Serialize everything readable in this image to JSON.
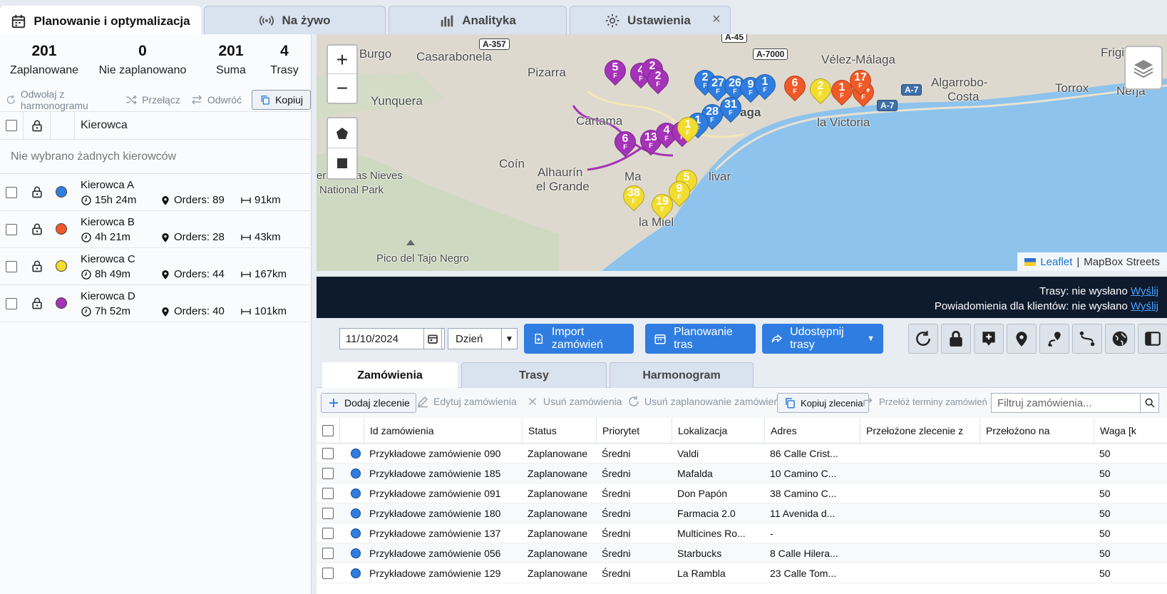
{
  "top_tabs": [
    {
      "label": "Planowanie i optymalizacja",
      "icon": "calendar-icon",
      "active": true
    },
    {
      "label": "Na żywo",
      "icon": "broadcast-icon",
      "active": false
    },
    {
      "label": "Analityka",
      "icon": "bar-chart-icon",
      "active": false
    },
    {
      "label": "Ustawienia",
      "icon": "gear-icon",
      "active": false
    }
  ],
  "tab_close": "×",
  "stats": [
    {
      "value": "201",
      "label": "Zaplanowane"
    },
    {
      "value": "0",
      "label": "Nie zaplanowano"
    },
    {
      "value": "201",
      "label": "Suma"
    },
    {
      "value": "4",
      "label": "Trasy"
    }
  ],
  "left_actions": {
    "unschedule": "Odwołaj z harmonogramu",
    "switch": "Przełącz",
    "reverse": "Odwróć",
    "copy": "Kopiuj"
  },
  "driver_header": {
    "label": "Kierowca"
  },
  "drivers_empty": "Nie wybrano żadnych kierowców",
  "drivers": [
    {
      "name": "Kierowca A",
      "color": "#2f7de1",
      "time": "15h 24m",
      "orders": "Orders: 89",
      "distance": "91km"
    },
    {
      "name": "Kierowca B",
      "color": "#f05a28",
      "time": "4h 21m",
      "orders": "Orders: 28",
      "distance": "43km"
    },
    {
      "name": "Kierowca C",
      "color": "#f2dc2e",
      "time": "8h 49m",
      "orders": "Orders: 44",
      "distance": "167km"
    },
    {
      "name": "Kierowca D",
      "color": "#a533b8",
      "time": "7h 52m",
      "orders": "Orders: 40",
      "distance": "101km"
    }
  ],
  "map": {
    "labels": {
      "el_burgo": "El Burgo",
      "casarabonela": "Casarabonela",
      "pizarra": "Pizarra",
      "yunquera": "Yunquera",
      "cartama": "Cártama",
      "coin": "Coín",
      "alhaurin1": "Alhaurín",
      "alhaurin2": "el Grande",
      "nieves1": "erra de las Nieves",
      "nieves2": "National Park",
      "pico": "Pico del Tajo Negro",
      "velez": "Vélez-Málaga",
      "frigili": "Frigili",
      "algarrobo1": "Algarrobo-",
      "algarrobo2": "Costa",
      "torrox": "Torrox",
      "nerja": "Nerja",
      "victoria": "la Victoria",
      "aga": "aga",
      "livar": "livar",
      "ma": "Ma",
      "la_miel": "la Miel"
    },
    "roads": {
      "a357": "A-357",
      "a45": "A-45",
      "a7000": "A-7000",
      "a7a": "A-7",
      "a7b": "A-7"
    },
    "zoom_in": "+",
    "zoom_out": "−",
    "attribution_leaflet": "Leaflet",
    "attribution_sep": "|",
    "attribution_tiles": "MapBox Streets",
    "pins": [
      {
        "n": "5",
        "f": "F",
        "color": "#a533b8"
      },
      {
        "n": "4",
        "f": "F",
        "color": "#a533b8"
      },
      {
        "n": "2",
        "f": "F",
        "color": "#a533b8"
      },
      {
        "n": "2",
        "f": "F",
        "color": "#a533b8"
      },
      {
        "n": "6",
        "f": "F",
        "color": "#a533b8"
      },
      {
        "n": "13",
        "f": "F",
        "color": "#a533b8"
      },
      {
        "n": "4",
        "f": "F",
        "color": "#a533b8"
      },
      {
        "n": "5",
        "f": "F",
        "color": "#a533b8"
      },
      {
        "n": "2",
        "f": "F",
        "color": "#2f7de1"
      },
      {
        "n": "27",
        "f": "F",
        "color": "#2f7de1"
      },
      {
        "n": "26",
        "f": "F",
        "color": "#2f7de1"
      },
      {
        "n": "9",
        "f": "F",
        "color": "#2f7de1"
      },
      {
        "n": "1",
        "f": "F",
        "color": "#2f7de1"
      },
      {
        "n": "28",
        "f": "F",
        "color": "#2f7de1"
      },
      {
        "n": "31",
        "f": "F",
        "color": "#2f7de1"
      },
      {
        "n": "1",
        "f": "F",
        "color": "#2f7de1"
      },
      {
        "n": "6",
        "f": "F",
        "color": "#f05a28"
      },
      {
        "n": "2",
        "f": "F",
        "color": "#f2dc2e"
      },
      {
        "n": "1",
        "f": "F",
        "color": "#f05a28"
      },
      {
        "n": "14",
        "f": "F",
        "color": "#f05a28"
      },
      {
        "n": "17",
        "f": "F",
        "color": "#f05a28"
      },
      {
        "n": "38",
        "f": "F",
        "color": "#f2dc2e"
      },
      {
        "n": "19",
        "f": "F",
        "color": "#f2dc2e"
      },
      {
        "n": "5",
        "f": "F",
        "color": "#f2dc2e"
      },
      {
        "n": "9",
        "f": "F",
        "color": "#f2dc2e"
      },
      {
        "n": "1",
        "f": "F",
        "color": "#f2dc2e"
      }
    ]
  },
  "status": {
    "routes_label": "Trasy: nie wysłano",
    "routes_link": "Wyślij",
    "notif_label": "Powiadomienia dla klientów: nie wysłano",
    "notif_link": "Wyślij"
  },
  "toolbar": {
    "date": "11/10/2024",
    "period": "Dzień",
    "import": "Import zamówień",
    "plan": "Planowanie tras",
    "share": "Udostępnij trasy"
  },
  "subtabs": [
    "Zamówienia",
    "Trasy",
    "Harmonogram"
  ],
  "order_tools": {
    "add": "Dodaj zlecenie",
    "edit": "Edytuj zamówienia",
    "delete": "Usuń zamówienia",
    "unschedule": "Usuń zaplanowanie zamówień",
    "copy": "Kopiuj zlecenia",
    "reschedule": "Przełóż terminy zamówień",
    "filter_placeholder": "Filtruj zamówienia..."
  },
  "table": {
    "columns": [
      "Id zamówienia",
      "Status",
      "Priorytet",
      "Lokalizacja",
      "Adres",
      "Przełożone zlecenie z",
      "Przełożono na",
      "Waga [k"
    ],
    "rows": [
      [
        "Przykładowe zamówienie 090",
        "Zaplanowane",
        "Średni",
        "Valdi",
        "86 Calle Crist...",
        "",
        "",
        "50"
      ],
      [
        "Przykładowe zamówienie 185",
        "Zaplanowane",
        "Średni",
        "Mafalda",
        "10 Camino C...",
        "",
        "",
        "50"
      ],
      [
        "Przykładowe zamówienie 091",
        "Zaplanowane",
        "Średni",
        "Don Papón",
        "38 Camino C...",
        "",
        "",
        "50"
      ],
      [
        "Przykładowe zamówienie 180",
        "Zaplanowane",
        "Średni",
        "Farmacia 2.0",
        "11 Avenida d...",
        "",
        "",
        "50"
      ],
      [
        "Przykładowe zamówienie 137",
        "Zaplanowane",
        "Średni",
        "Multicines Ro...",
        "-",
        "",
        "",
        "50"
      ],
      [
        "Przykładowe zamówienie 056",
        "Zaplanowane",
        "Średni",
        "Starbucks",
        "8 Calle Hilera...",
        "",
        "",
        "50"
      ],
      [
        "Przykładowe zamówienie 129",
        "Zaplanowane",
        "Średni",
        "La Rambla",
        "23 Calle Tom...",
        "",
        "",
        "50"
      ]
    ]
  }
}
